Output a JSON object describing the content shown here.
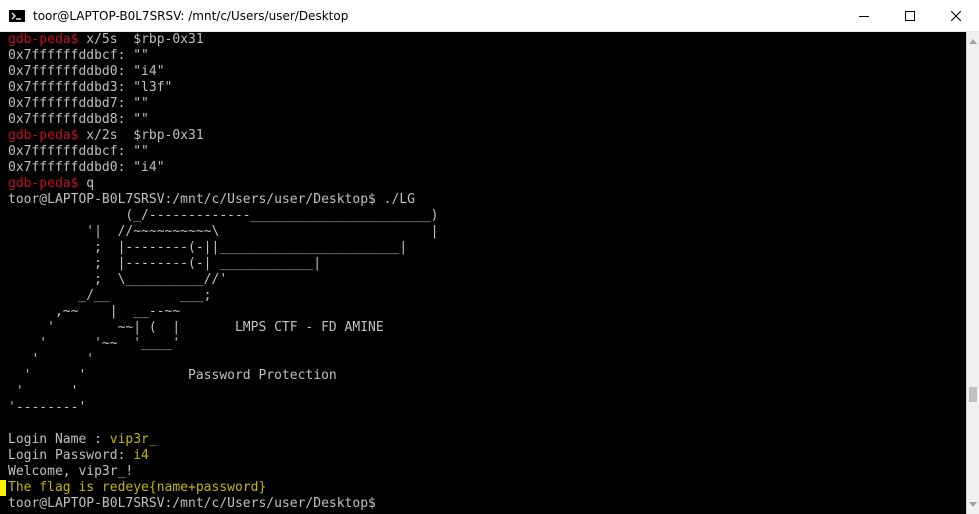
{
  "window": {
    "title": "toor@LAPTOP-B0L7SRSV: /mnt/c/Users/user/Desktop"
  },
  "controls": {
    "minimize_icon": "minimize-icon",
    "maximize_icon": "maximize-icon",
    "close_icon": "close-icon"
  },
  "colors": {
    "prompt": "#c50f1f",
    "output": "#c0c0c0",
    "highlight": "#c1b600",
    "cursor": "#f9f100",
    "background": "#000000"
  },
  "terminal": {
    "lines": [
      [
        {
          "t": "gdb-peda$",
          "c": "prompt"
        },
        {
          "t": " x/5s  $rbp-0x31"
        }
      ],
      [
        {
          "t": "0x7ffffffddbcf: \"\""
        }
      ],
      [
        {
          "t": "0x7ffffffddbd0: \"i4\""
        }
      ],
      [
        {
          "t": "0x7ffffffddbd3: \"l3f\""
        }
      ],
      [
        {
          "t": "0x7ffffffddbd7: \"\""
        }
      ],
      [
        {
          "t": "0x7ffffffddbd8: \"\""
        }
      ],
      [
        {
          "t": "gdb-peda$",
          "c": "prompt"
        },
        {
          "t": " x/2s  $rbp-0x31"
        }
      ],
      [
        {
          "t": "0x7ffffffddbcf: \"\""
        }
      ],
      [
        {
          "t": "0x7ffffffddbd0: \"i4\""
        }
      ],
      [
        {
          "t": "gdb-peda$",
          "c": "prompt"
        },
        {
          "t": " q"
        }
      ],
      [
        {
          "t": "toor@LAPTOP-B0L7SRSV:/mnt/c/Users/user/Desktop$ ./LG"
        }
      ],
      [
        {
          "t": "               (_/-------------_______________________)"
        }
      ],
      [
        {
          "t": "          '|  //~~~~~~~~~~\\                           |"
        }
      ],
      [
        {
          "t": "           ;  |--------(-||_______________________|"
        }
      ],
      [
        {
          "t": "           ;  |--------(-| ____________|"
        }
      ],
      [
        {
          "t": "           ;  \\__________//'"
        }
      ],
      [
        {
          "t": "         _/__         ___;"
        }
      ],
      [
        {
          "t": "      ,~~    |  __--~~"
        }
      ],
      [
        {
          "t": "     '        ~~| (  |       LMPS CTF - FD AMINE"
        }
      ],
      [
        {
          "t": "    '      '~~  '____'"
        }
      ],
      [
        {
          "t": "   '      '"
        }
      ],
      [
        {
          "t": "  '      '             Password Protection"
        }
      ],
      [
        {
          "t": " '      '"
        }
      ],
      [
        {
          "t": "'--------'"
        }
      ],
      [
        {
          "t": ""
        }
      ],
      [
        {
          "t": "Login Name : "
        },
        {
          "t": "vip3r_",
          "c": "yellow"
        }
      ],
      [
        {
          "t": "Login Password: "
        },
        {
          "t": "i4",
          "c": "yellow"
        }
      ],
      [
        {
          "t": "Welcome, vip3r_!"
        }
      ],
      [
        {
          "t": "The flag is redeye{name+password}",
          "c": "yellow"
        }
      ],
      [
        {
          "t": "toor@LAPTOP-B0L7SRSV:/mnt/c/Users/user/Desktop$"
        }
      ]
    ]
  }
}
